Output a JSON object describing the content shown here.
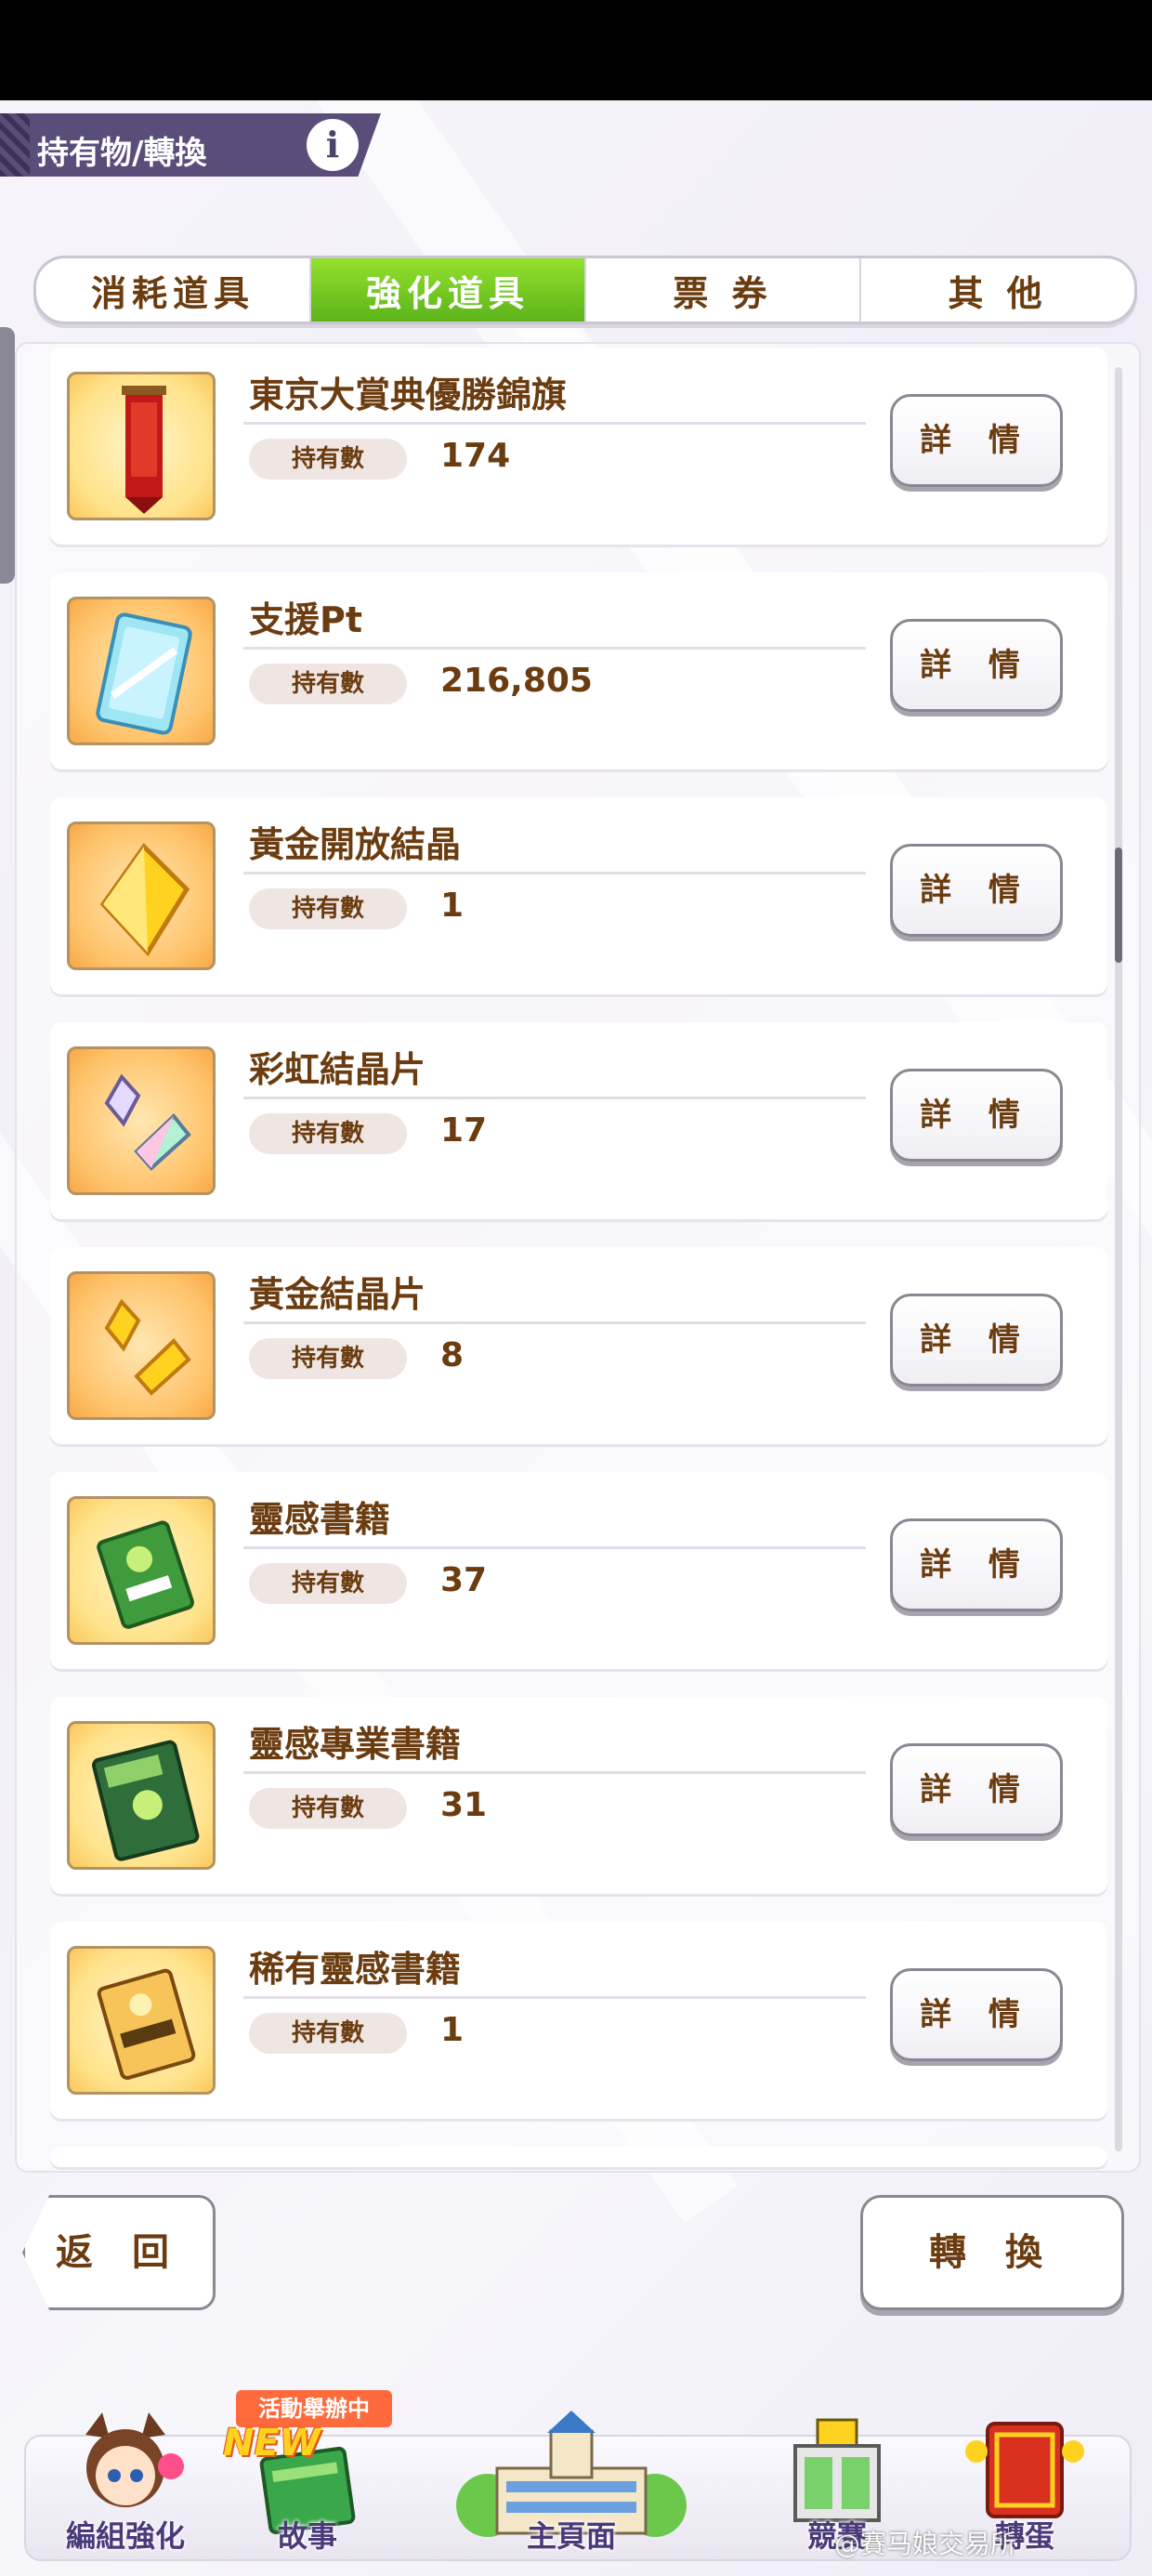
{
  "header": {
    "title": "持有物/轉換",
    "info_label": "i"
  },
  "tabs": [
    {
      "label": "消耗道具",
      "active": false
    },
    {
      "label": "強化道具",
      "active": true
    },
    {
      "label": "票 券",
      "active": false
    },
    {
      "label": "其 他",
      "active": false
    }
  ],
  "items": [
    {
      "name": "東京大賞典優勝錦旗",
      "count_label": "持有數",
      "count": "174",
      "icon": "pennant-icon",
      "detail_label": "詳 情"
    },
    {
      "name": "支援Pt",
      "count_label": "持有數",
      "count": "216,805",
      "icon": "support-card-icon",
      "detail_label": "詳 情"
    },
    {
      "name": "黃金開放結晶",
      "count_label": "持有數",
      "count": "1",
      "icon": "gold-crystal-icon",
      "detail_label": "詳 情"
    },
    {
      "name": "彩虹結晶片",
      "count_label": "持有數",
      "count": "17",
      "icon": "rainbow-shard-icon",
      "detail_label": "詳 情"
    },
    {
      "name": "黃金結晶片",
      "count_label": "持有數",
      "count": "8",
      "icon": "gold-shard-icon",
      "detail_label": "詳 情"
    },
    {
      "name": "靈感書籍",
      "count_label": "持有數",
      "count": "37",
      "icon": "green-book-icon",
      "detail_label": "詳 情"
    },
    {
      "name": "靈感專業書籍",
      "count_label": "持有數",
      "count": "31",
      "icon": "pro-book-icon",
      "detail_label": "詳 情"
    },
    {
      "name": "稀有靈感書籍",
      "count_label": "持有數",
      "count": "1",
      "icon": "rare-book-icon",
      "detail_label": "詳 情"
    }
  ],
  "footer": {
    "back_label": "返 回",
    "convert_label": "轉 換"
  },
  "nav": [
    {
      "label": "編組強化",
      "icon": "character-icon"
    },
    {
      "label": "故事",
      "icon": "story-book-icon"
    },
    {
      "label": "主頁面",
      "icon": "school-building-icon"
    },
    {
      "label": "競賽",
      "icon": "race-gate-icon"
    },
    {
      "label": "轉蛋",
      "icon": "gacha-icon"
    }
  ],
  "badges": {
    "event": "活動舉辦中",
    "new": "NEW"
  },
  "watermark": "@賽马娘交易所",
  "colors": {
    "accent_green": "#6cc21f",
    "text_brown": "#6b3c10",
    "nav_purple": "#4a3a7a"
  }
}
